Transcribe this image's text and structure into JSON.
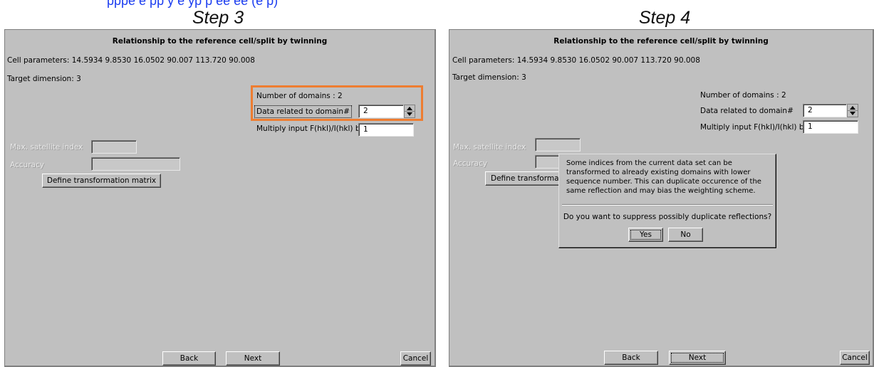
{
  "top_link": "pppe e pp y e yp p ee ee (e p)",
  "step3": {
    "step_title": "Step 3",
    "dialog_title": "Relationship to the reference cell/split by twinning",
    "cell_parameters": "Cell parameters: 14.5934 9.8530 16.0502 90.007 113.720 90.008",
    "target_dimension": "Target dimension: 3",
    "number_of_domains": "Number of domains : 2",
    "data_related_label": "Data related to domain#",
    "data_related_value": "2",
    "multiply_label": "Multiply input F(hkl)/I(hkl) by",
    "multiply_value": "1",
    "max_satellite_label": "Max. satellite index",
    "accuracy_label": "Accuracy",
    "define_matrix_button": "Define transformation matrix",
    "back_button": "Back",
    "next_button": "Next",
    "cancel_button": "Cancel",
    "highlight_color": "#ee7d31"
  },
  "step4": {
    "step_title": "Step 4",
    "dialog_title": "Relationship to the reference cell/split by twinning",
    "cell_parameters": "Cell parameters: 14.5934 9.8530 16.0502 90.007 113.720 90.008",
    "target_dimension": "Target dimension: 3",
    "number_of_domains": "Number of domains : 2",
    "data_related_label": "Data related to domain#",
    "data_related_value": "2",
    "multiply_label": "Multiply input F(hkl)/I(hkl) by",
    "multiply_value": "1",
    "max_satellite_label": "Max. satellite index",
    "accuracy_label": "Accuracy",
    "define_matrix_button": "Define transformatio",
    "back_button": "Back",
    "next_button": "Next",
    "cancel_button": "Cancel",
    "popup": {
      "message": "Some indices from the current data set can be transformed to already existing domains with lower sequence number. This can duplicate occurence of the same reflection and may bias the weighting scheme.",
      "question": "Do you want to suppress possibly duplicate reflections?",
      "yes_button": "Yes",
      "no_button": "No"
    }
  }
}
